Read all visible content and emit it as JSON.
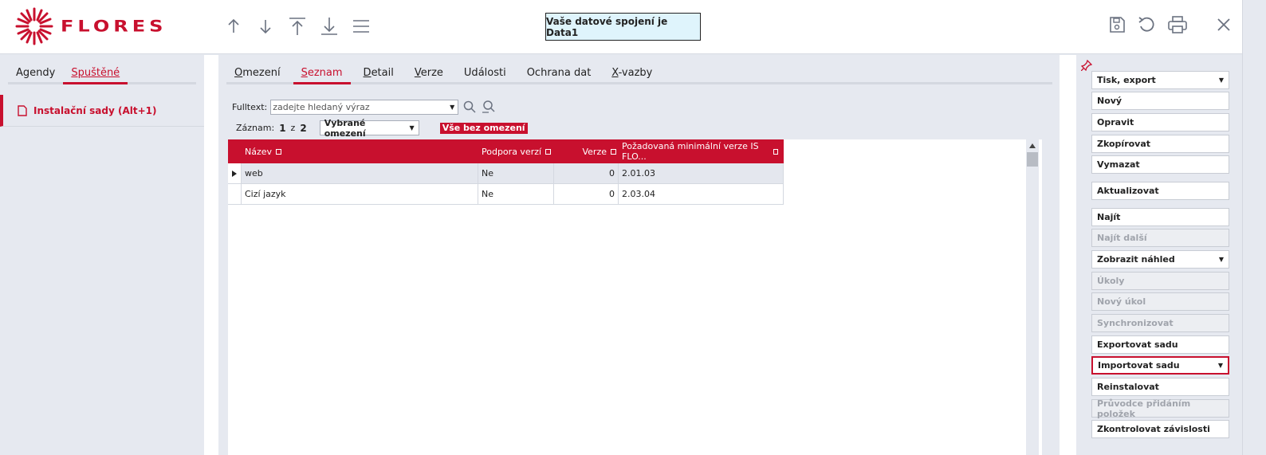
{
  "header": {
    "logo_text": "FLORES",
    "connection_text": "Vaše datové spojení je Data1",
    "brand_color": "#c8102e"
  },
  "left": {
    "tabs": [
      {
        "label": "Agendy",
        "active": false
      },
      {
        "label": "Spuštěné",
        "active": true
      }
    ],
    "item_label": "Instalační sady (Alt+1)"
  },
  "main": {
    "tabs": [
      {
        "label": "Omezení",
        "key": "O",
        "rest": "mezení",
        "active": false
      },
      {
        "label": "Seznam",
        "key": "S",
        "rest": "eznam",
        "active": true
      },
      {
        "label": "Detail",
        "key": "D",
        "rest": "etail",
        "active": false
      },
      {
        "label": "Verze",
        "key": "V",
        "rest": "erze",
        "active": false
      },
      {
        "label": "Události",
        "key": "",
        "rest": "Události",
        "active": false
      },
      {
        "label": "Ochrana dat",
        "key": "",
        "rest": "Ochrana dat",
        "active": false
      },
      {
        "label": "X-vazby",
        "key": "X",
        "rest": "-vazby",
        "active": false
      }
    ],
    "fulltext_label": "Fulltext:",
    "fulltext_placeholder": "zadejte hledaný výraz",
    "zaznam_label": "Záznam:",
    "zaznam_current": "1",
    "zaznam_sep": "z",
    "zaznam_total": "2",
    "filter_select": "Vybrané omezení",
    "no_filter_label": "Vše bez omezení"
  },
  "grid": {
    "columns": [
      "Název",
      "Podpora verzí",
      "Verze",
      "Požadovaná minimální verze IS FLO..."
    ],
    "rows": [
      {
        "nazev": "web",
        "podpora": "Ne",
        "verze": "0",
        "min_verze": "2.01.03",
        "selected": true
      },
      {
        "nazev": "Cizí jazyk",
        "podpora": "Ne",
        "verze": "0",
        "min_verze": "2.03.04",
        "selected": false
      }
    ]
  },
  "actions": [
    {
      "label": "Tisk, export",
      "dropdown": true,
      "disabled": false
    },
    {
      "label": "Nový",
      "dropdown": false,
      "disabled": false
    },
    {
      "label": "Opravit",
      "dropdown": false,
      "disabled": false
    },
    {
      "label": "Zkopírovat",
      "dropdown": false,
      "disabled": false
    },
    {
      "label": "Vymazat",
      "dropdown": false,
      "disabled": false
    },
    {
      "label": "Aktualizovat",
      "dropdown": false,
      "disabled": false
    },
    {
      "label": "Najít",
      "dropdown": false,
      "disabled": false
    },
    {
      "label": "Najít další",
      "dropdown": false,
      "disabled": true
    },
    {
      "label": "Zobrazit náhled",
      "dropdown": true,
      "disabled": false
    },
    {
      "label": "Úkoly",
      "dropdown": false,
      "disabled": true
    },
    {
      "label": "Nový úkol",
      "dropdown": false,
      "disabled": true
    },
    {
      "label": "Synchronizovat",
      "dropdown": false,
      "disabled": true
    },
    {
      "label": "Exportovat sadu",
      "dropdown": false,
      "disabled": false
    },
    {
      "label": "Importovat sadu",
      "dropdown": true,
      "disabled": false,
      "highlighted": true
    },
    {
      "label": "Reinstalovat",
      "dropdown": false,
      "disabled": false
    },
    {
      "label": "Průvodce přidáním položek",
      "dropdown": false,
      "disabled": true
    },
    {
      "label": "Zkontrolovat závislosti",
      "dropdown": false,
      "disabled": false
    }
  ]
}
